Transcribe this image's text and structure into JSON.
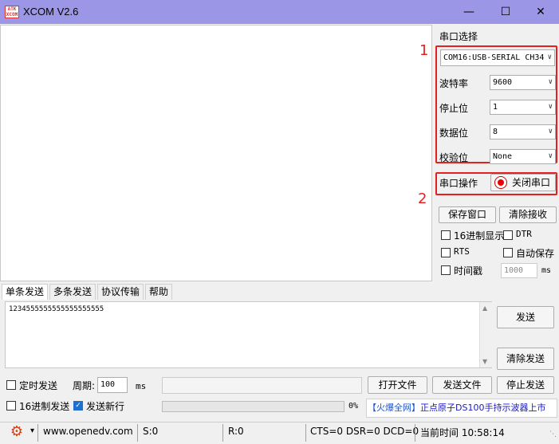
{
  "window": {
    "title": "XCOM V2.6",
    "logo_text": "ATK XCOM"
  },
  "right_panel": {
    "port_group_title": "串口选择",
    "port_value": "COM16:USB-SERIAL CH34",
    "baud_label": "波特率",
    "baud_value": "9600",
    "stop_label": "停止位",
    "stop_value": "1",
    "data_label": "数据位",
    "data_value": "8",
    "parity_label": "校验位",
    "parity_value": "None",
    "op_label": "串口操作",
    "op_button": "关闭串口",
    "save_window": "保存窗口",
    "clear_receive": "清除接收",
    "hex_display": "16进制显示",
    "dtr": "DTR",
    "rts": "RTS",
    "auto_save": "自动保存",
    "timestamp": "时间戳",
    "timestamp_value": "1000",
    "timestamp_unit": "ms"
  },
  "annotations": {
    "one": "1",
    "two": "2"
  },
  "tabs": [
    "单条发送",
    "多条发送",
    "协议传输",
    "帮助"
  ],
  "send": {
    "text": "1234555555555555555555",
    "send_button": "发送",
    "clear_send_button": "清除发送"
  },
  "bottom": {
    "timed_send": "定时发送",
    "period_label": "周期:",
    "period_value": "100",
    "period_unit": "ms",
    "open_file": "打开文件",
    "send_file": "发送文件",
    "stop_send": "停止发送",
    "hex_send": "16进制发送",
    "newline": "发送新行",
    "progress": "0%",
    "ad_bracket": "【火爆全网】",
    "ad_text": "正点原子DS100手持示波器上市"
  },
  "status": {
    "url": "www.openedv.com",
    "s": "S:0",
    "r": "R:0",
    "lines": "CTS=0 DSR=0 DCD=0",
    "time": "当前时间 10:58:14"
  },
  "colors": {
    "titlebar": "#9b96e5",
    "annotation_red": "#e62020",
    "checked_blue": "#1f6fcf"
  }
}
